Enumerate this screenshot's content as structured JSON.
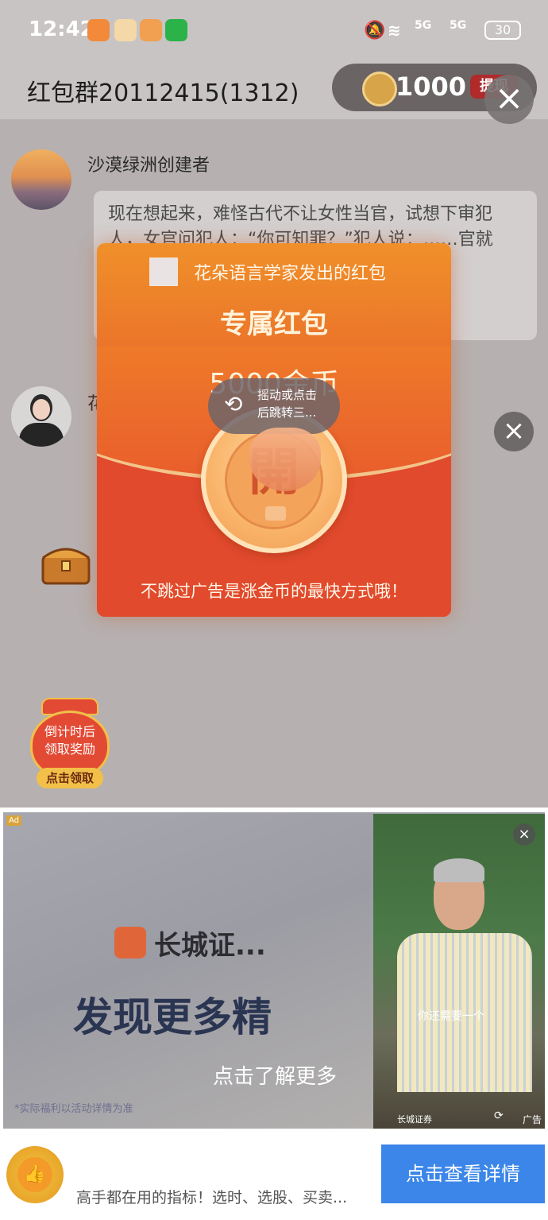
{
  "status_bar": {
    "time": "12:42",
    "signal_1": "5G",
    "signal_2": "5G",
    "battery": "30"
  },
  "header": {
    "title": "红包群20112415(1312)",
    "coins": "1000",
    "withdraw_label": "提现"
  },
  "chat": {
    "messages": [
      {
        "sender": "沙漠绿洲创建者",
        "text": "现在想起来，难怪古代不让女性当官，试想下审犯人，女官问犯人：“你可知罪？”犯人说：……官就条……里会"
      },
      {
        "sender": "花"
      }
    ]
  },
  "red_packet": {
    "from": "花朵语言学家发出的红包",
    "title": "专属红包",
    "amount": "5000金币",
    "open_char": "開",
    "tip": "不跳过广告是涨金币的最快方式哦！"
  },
  "lucky_bag": {
    "line1": "倒计时后",
    "line2": "领取奖励",
    "button": "点击领取"
  },
  "ad": {
    "tag": "Ad",
    "brand": "长城证...",
    "slogan": "发现更多精",
    "shake_line1": "摇动或点击",
    "shake_line2": "后跳转三...",
    "learn_more": "点击了解更多",
    "disclaimer": "*实际福利以活动详情为准",
    "video_caption": "你还需要一个",
    "video_brand": "长城证券",
    "video_ad_label": "广告",
    "bottom_text": "高手都在用的指标！选时、选股、买卖...",
    "detail_button": "点击查看详情"
  }
}
